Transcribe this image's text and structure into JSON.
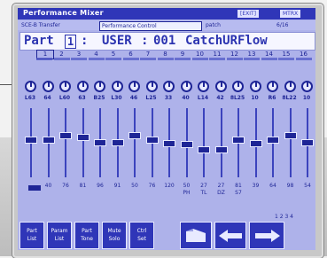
{
  "header": {
    "title": "Performance Mixer",
    "tag1": "[EXIT]",
    "tag2": "MTRX"
  },
  "row2": {
    "left": "SCE-B Transfer",
    "mid": "Performance Control",
    "right1": "patch",
    "right2": "6/16"
  },
  "part": {
    "label": "Part",
    "number": "1",
    "sep": ":",
    "bank": "USER",
    "patch_no": "001",
    "patch_name": "CatchURFlow"
  },
  "channels": [
    "1",
    "2",
    "3",
    "4",
    "5",
    "6",
    "7",
    "8",
    "9",
    "10",
    "11",
    "12",
    "13",
    "14",
    "15",
    "16"
  ],
  "knob_values": [
    "L63",
    "64",
    "L60",
    "63",
    "B25",
    "L30",
    "46",
    "L25",
    "33",
    "40",
    "L14",
    "42",
    "8L25",
    "10",
    "R6",
    "8L22",
    "10"
  ],
  "fader_values": [
    "",
    "40",
    "76",
    "81",
    "96",
    "91",
    "50",
    "76",
    "120",
    "50",
    "27",
    "27",
    "81",
    "39",
    "64",
    "98",
    "54"
  ],
  "fader_levels": [
    0.55,
    0.55,
    0.62,
    0.6,
    0.52,
    0.52,
    0.62,
    0.56,
    0.5,
    0.48,
    0.4,
    0.4,
    0.56,
    0.5,
    0.56,
    0.62,
    0.52
  ],
  "sub_labels": [
    "",
    "",
    "",
    "",
    "",
    "",
    "",
    "",
    "",
    "PH",
    "TL",
    "DZ",
    "S7",
    "",
    "",
    "",
    ""
  ],
  "buttons": [
    {
      "line1": "Part",
      "line2": "List"
    },
    {
      "line1": "Param",
      "line2": "List"
    },
    {
      "line1": "Part",
      "line2": "Tone"
    },
    {
      "line1": "Mute",
      "line2": "Solo"
    },
    {
      "line1": "Ctrl",
      "line2": "Set"
    }
  ],
  "status": "1 2 3 4"
}
